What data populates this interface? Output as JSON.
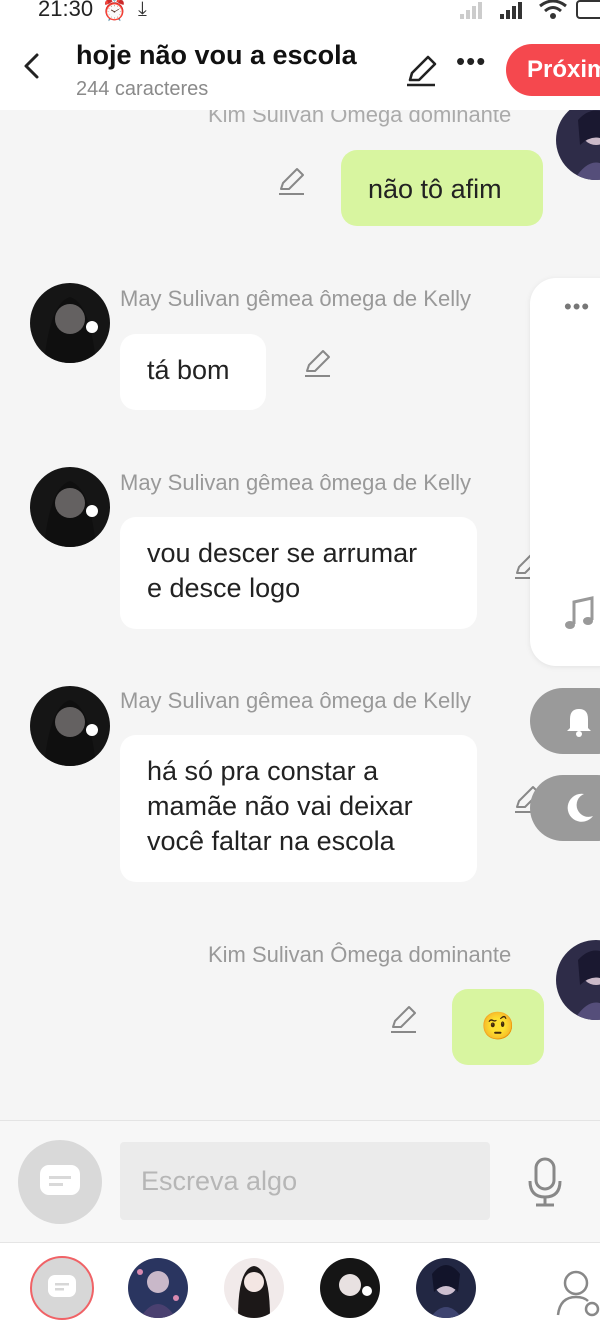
{
  "status_bar": {
    "time": "21:30"
  },
  "header": {
    "title": "hoje não vou a escola",
    "subtitle": "244 caracteres",
    "next_label": "Próximo"
  },
  "messages": [
    {
      "sender": "Kim Sulivan  Ômega dominante",
      "text": "não tô afim",
      "side": "right"
    },
    {
      "sender": "May Sulivan gêmea ômega de Kelly",
      "text": "tá bom",
      "side": "left"
    },
    {
      "sender": "May Sulivan gêmea ômega de Kelly",
      "lines": [
        "vou descer se arrumar",
        "e desce logo"
      ],
      "side": "left"
    },
    {
      "sender": "May Sulivan gêmea ômega de Kelly",
      "lines": [
        "há só pra constar a",
        "mamãe não vai deixar",
        "você faltar na escola"
      ],
      "side": "left"
    },
    {
      "sender": "Kim Sulivan  Ômega dominante",
      "text": "🤨",
      "side": "right"
    }
  ],
  "input": {
    "placeholder": "Escreva algo"
  },
  "colors": {
    "accent": "#f5484e",
    "my_bubble": "#d8f5a0",
    "other_bubble": "#ffffff"
  },
  "icons": [
    "back-arrow-icon",
    "pencil-icon",
    "more-icon",
    "music-note-icon",
    "bell-icon",
    "moon-icon",
    "chat-bubble-icon",
    "microphone-icon",
    "user-settings-icon"
  ]
}
